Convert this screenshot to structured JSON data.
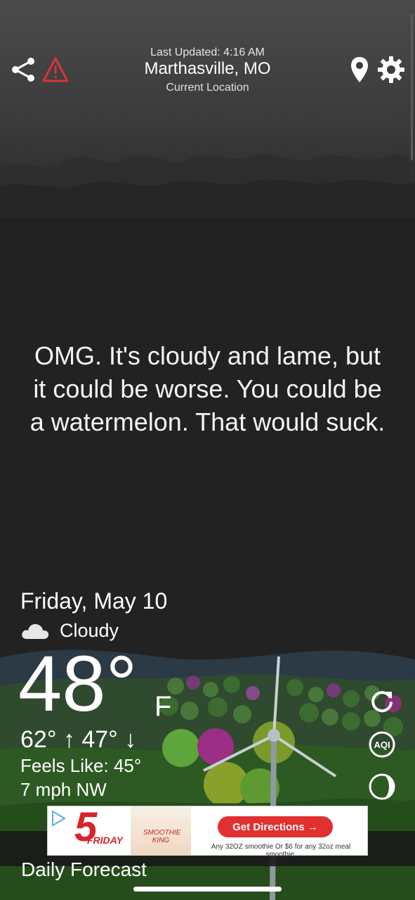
{
  "header": {
    "last_updated": "Last Updated: 4:16 AM",
    "city": "Marthasville, MO",
    "subtitle": "Current Location",
    "icons": [
      "share-icon",
      "alert-icon",
      "location-pin-icon",
      "settings-gear-icon"
    ]
  },
  "quip": "OMG. It's cloudy and lame, but it could be worse. You could be a watermelon. That would suck.",
  "weather": {
    "date": "Friday, May 10",
    "condition": "Cloudy",
    "condition_icon": "cloud-icon",
    "temperature": "48°",
    "unit": "F",
    "high": "62°",
    "low": "47°",
    "feels_like": "Feels Like: 45°",
    "wind": "7 mph NW"
  },
  "side_buttons": [
    "refresh-icon",
    "aqi-icon",
    "moon-phase-icon"
  ],
  "aqi_label": "AQI",
  "ad": {
    "price": "5",
    "day": "FRIDAY",
    "brand": "SMOOTHIE KING",
    "cta": "Get Directions →",
    "fine_print": "Any 32OZ smoothie Or $6 for any 32oz meal smoothie."
  },
  "next_section": "Daily Forecast",
  "colors": {
    "background": "#222222",
    "accent_red": "#e0302f",
    "alert_red": "#d9333a",
    "foliage_green": "#3e7a2c",
    "foliage_purple": "#8b2f7a"
  }
}
